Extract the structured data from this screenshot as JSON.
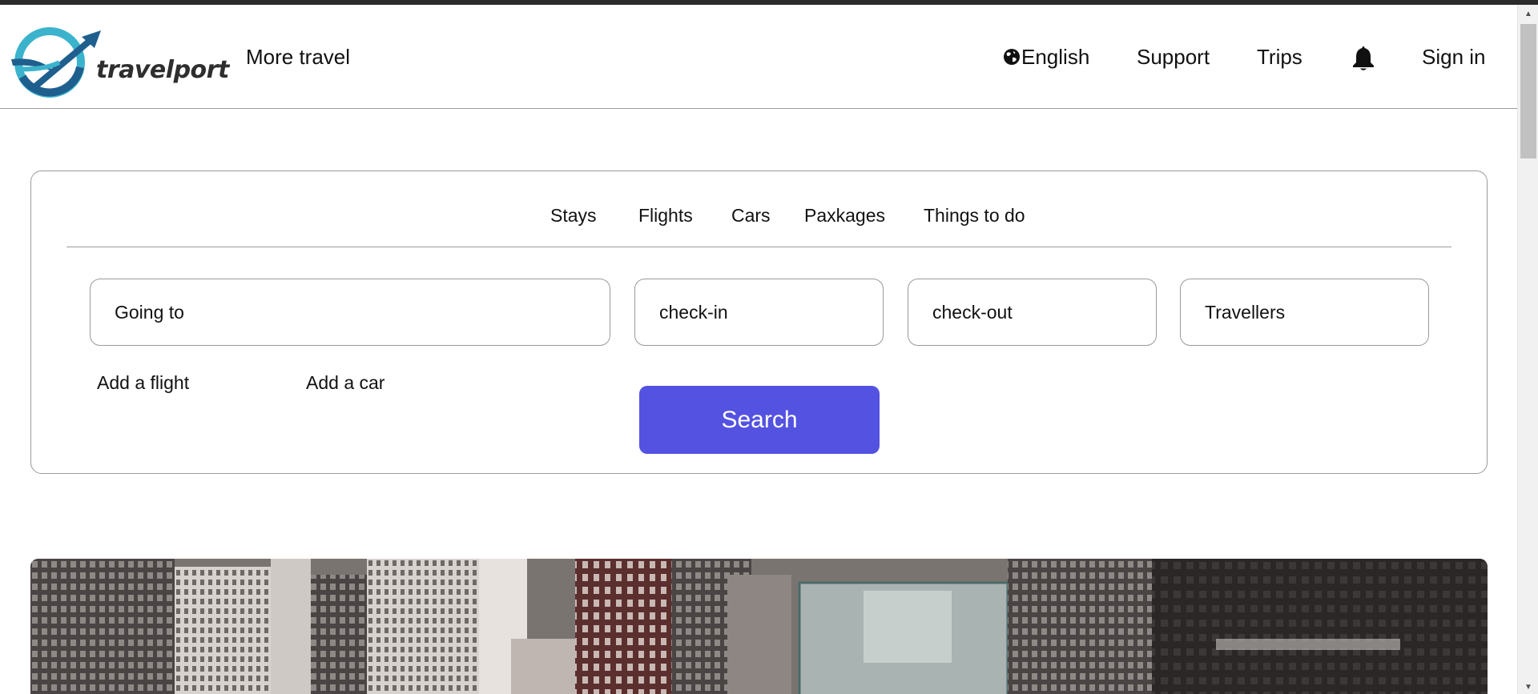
{
  "header": {
    "logo_text": "travelport",
    "more_travel": "More travel",
    "language": "English",
    "support": "Support",
    "trips": "Trips",
    "sign_in": "Sign in"
  },
  "search": {
    "tabs": [
      {
        "label": "Stays"
      },
      {
        "label": "Flights"
      },
      {
        "label": "Cars"
      },
      {
        "label": "Paxkages"
      },
      {
        "label": "Things to do"
      }
    ],
    "going_to_placeholder": "Going to",
    "check_in_placeholder": "check-in",
    "check_out_placeholder": "check-out",
    "travellers_placeholder": "Travellers",
    "add_flight": "Add a flight",
    "add_car": "Add a car",
    "search_button": "Search"
  },
  "colors": {
    "accent": "#5352e1",
    "logo_teal": "#3bb3cc",
    "logo_blue": "#1f5f8e"
  },
  "icons": {
    "language": "globe-icon",
    "notifications": "bell-icon"
  }
}
